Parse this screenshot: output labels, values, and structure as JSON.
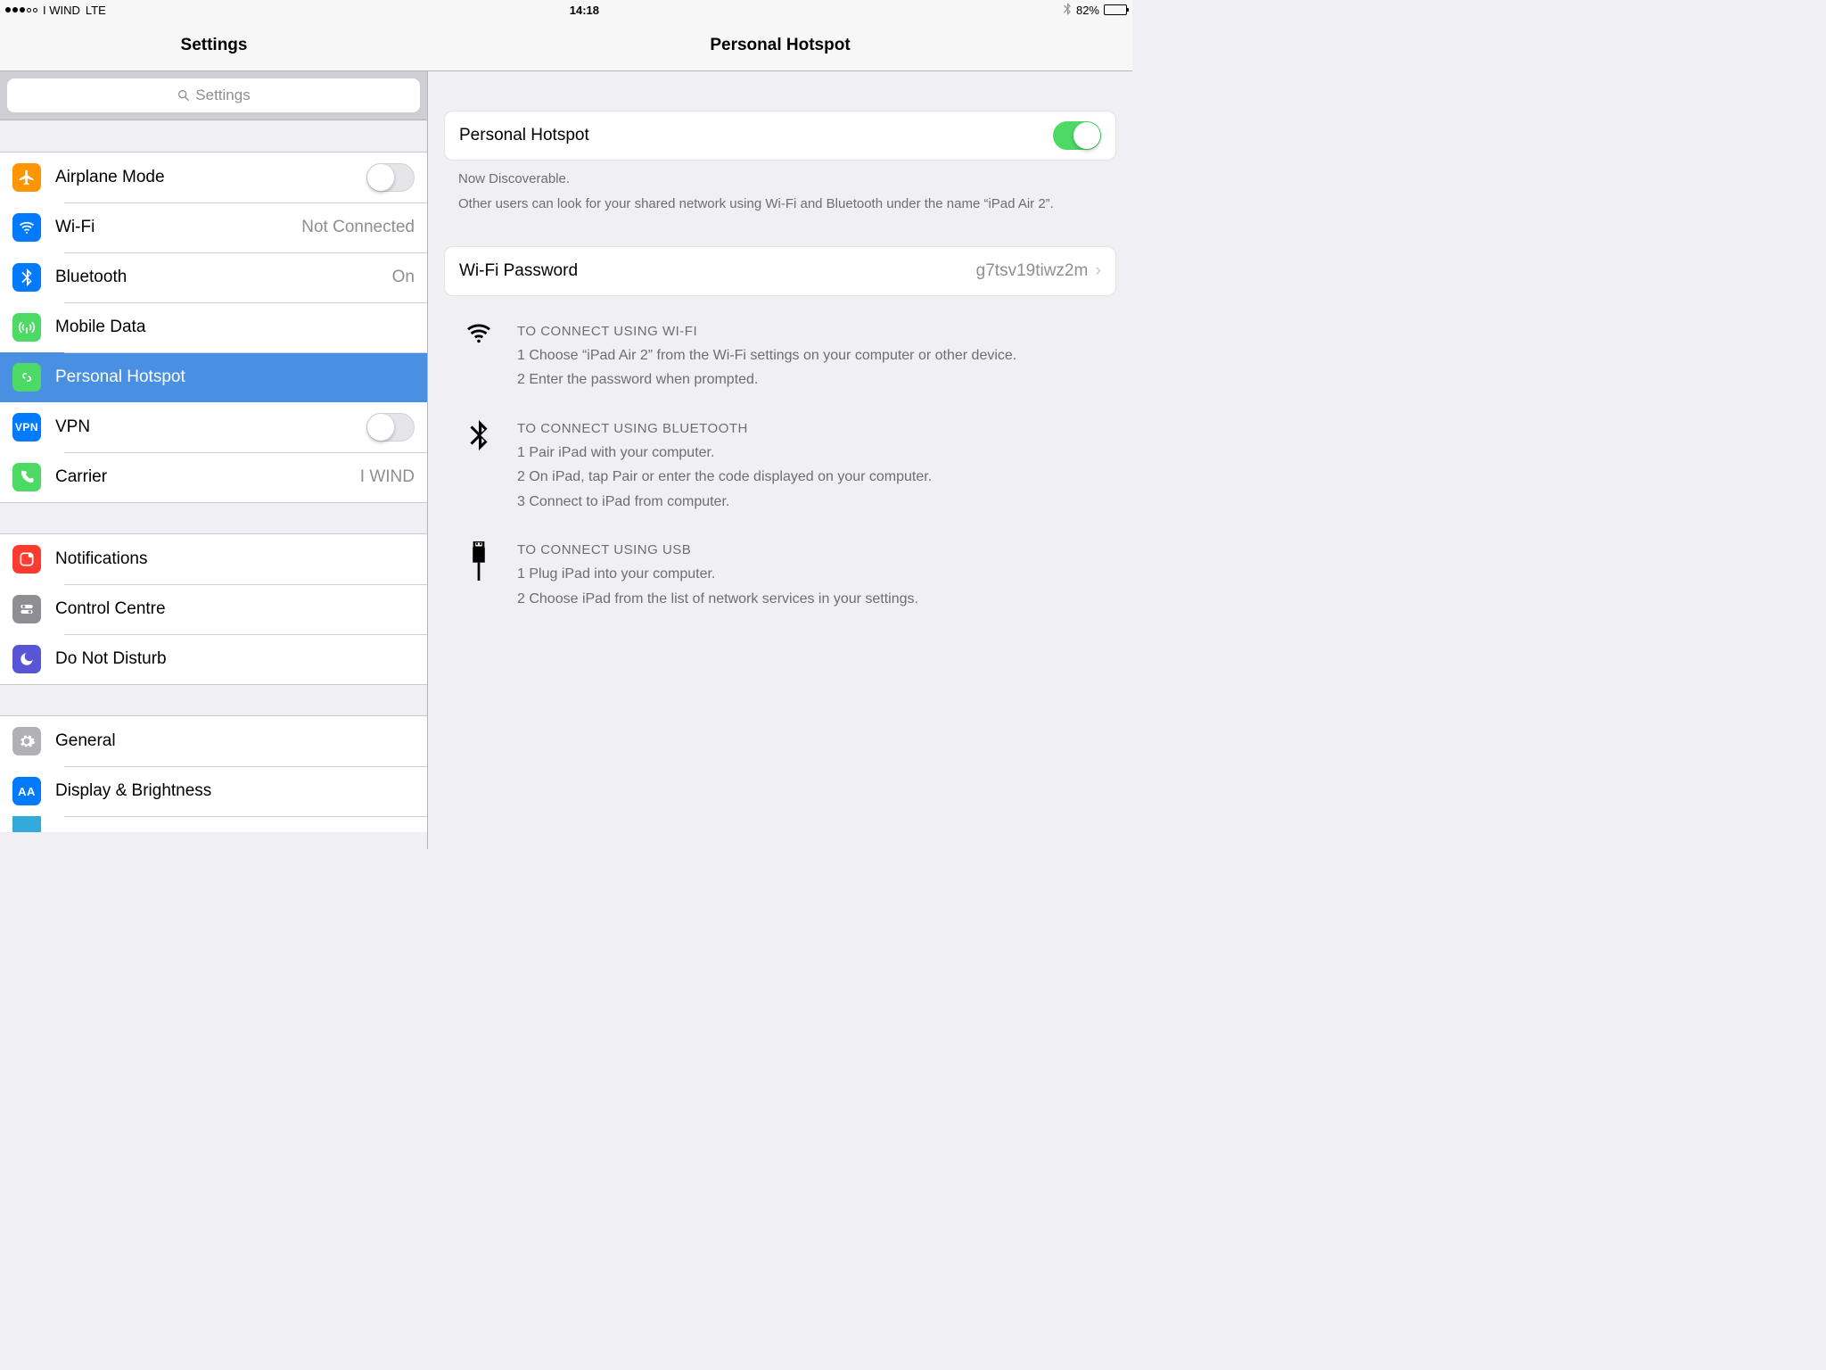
{
  "statusbar": {
    "carrier": "I WIND",
    "network": "LTE",
    "time": "14:18",
    "battery_pct": "82%"
  },
  "header": {
    "left_title": "Settings",
    "right_title": "Personal Hotspot"
  },
  "search": {
    "placeholder": "Settings"
  },
  "sidebar": {
    "g1": [
      {
        "label": "Airplane Mode",
        "value": ""
      },
      {
        "label": "Wi-Fi",
        "value": "Not Connected"
      },
      {
        "label": "Bluetooth",
        "value": "On"
      },
      {
        "label": "Mobile Data",
        "value": ""
      },
      {
        "label": "Personal Hotspot",
        "value": ""
      },
      {
        "label": "VPN",
        "value": ""
      },
      {
        "label": "Carrier",
        "value": "I WIND"
      }
    ],
    "g2": [
      {
        "label": "Notifications"
      },
      {
        "label": "Control Centre"
      },
      {
        "label": "Do Not Disturb"
      }
    ],
    "g3": [
      {
        "label": "General"
      },
      {
        "label": "Display & Brightness"
      }
    ]
  },
  "main": {
    "hotspot_row_label": "Personal Hotspot",
    "hotspot_on": true,
    "discoverable_title": "Now Discoverable.",
    "discoverable_body": "Other users can look for your shared network using Wi-Fi and Bluetooth under the name “iPad Air 2”.",
    "password_label": "Wi-Fi Password",
    "password_value": "g7tsv19tiwz2m",
    "instr_wifi": {
      "title": "TO CONNECT USING WI-FI",
      "l1": "1 Choose “iPad Air 2” from the Wi-Fi settings on your computer or other device.",
      "l2": "2 Enter the password when prompted."
    },
    "instr_bt": {
      "title": "TO CONNECT USING BLUETOOTH",
      "l1": "1 Pair iPad with your computer.",
      "l2": "2 On iPad, tap Pair or enter the code displayed on your computer.",
      "l3": "3 Connect to iPad from computer."
    },
    "instr_usb": {
      "title": "TO CONNECT USING USB",
      "l1": "1 Plug iPad into your computer.",
      "l2": "2 Choose iPad from the list of network services in your settings."
    }
  }
}
